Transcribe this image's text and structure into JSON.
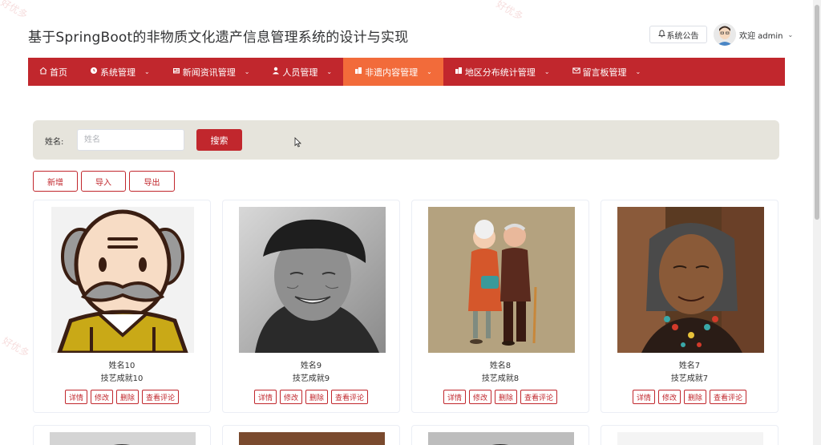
{
  "header": {
    "title": "基于SpringBoot的非物质文化遗产信息管理系统的设计与实现",
    "notice_label": "系统公告",
    "welcome": "欢迎 admin"
  },
  "nav": {
    "items": [
      {
        "label": "首页",
        "icon": "home-icon"
      },
      {
        "label": "系统管理",
        "icon": "system-icon"
      },
      {
        "label": "新闻资讯管理",
        "icon": "news-icon"
      },
      {
        "label": "人员管理",
        "icon": "person-icon"
      },
      {
        "label": "非遗内容管理",
        "icon": "building-icon",
        "active": true
      },
      {
        "label": "地区分布统计管理",
        "icon": "building-icon"
      },
      {
        "label": "留言板管理",
        "icon": "mail-icon"
      }
    ]
  },
  "search": {
    "label": "姓名:",
    "placeholder": "姓名",
    "button": "搜索"
  },
  "actions": {
    "add": "新增",
    "import": "导入",
    "export": "导出"
  },
  "cards": [
    {
      "name": "姓名10",
      "achievement": "技艺成就10"
    },
    {
      "name": "姓名9",
      "achievement": "技艺成就9"
    },
    {
      "name": "姓名8",
      "achievement": "技艺成就8"
    },
    {
      "name": "姓名7",
      "achievement": "技艺成就7"
    }
  ],
  "card_ops": {
    "detail": "详情",
    "edit": "修改",
    "delete": "删除",
    "comments": "查看评论"
  },
  "watermark": "好优多",
  "colors": {
    "primary": "#c1272d",
    "active_nav": "#f26b3a",
    "search_bg": "#e6e4dc"
  }
}
